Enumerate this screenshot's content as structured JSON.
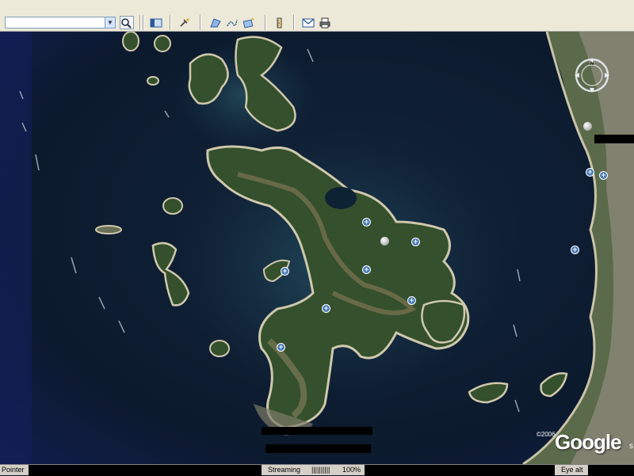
{
  "toolbar": {
    "search_value": "",
    "search_placeholder": "",
    "buttons": [
      "search",
      "sidebar-toggle",
      "satellite-placemark",
      "polygon",
      "path",
      "overlay",
      "ruler",
      "email",
      "print"
    ]
  },
  "map": {
    "compass_north_label": "N",
    "markers": 10,
    "copyright_year": "©2006",
    "brand": "Google",
    "brand_tail": "s"
  },
  "statusbar": {
    "pointer_label": "Pointer",
    "streaming_label": "Streaming",
    "streaming_bar": "||||||||||",
    "streaming_percent": "100%",
    "eye_alt_label": "Eye alt"
  },
  "colors": {
    "sea": "#0b1a2c",
    "land": "#2f4a2a",
    "toolbar_bg": "#ece9d8",
    "marker_blue": "#4d7fb6"
  }
}
